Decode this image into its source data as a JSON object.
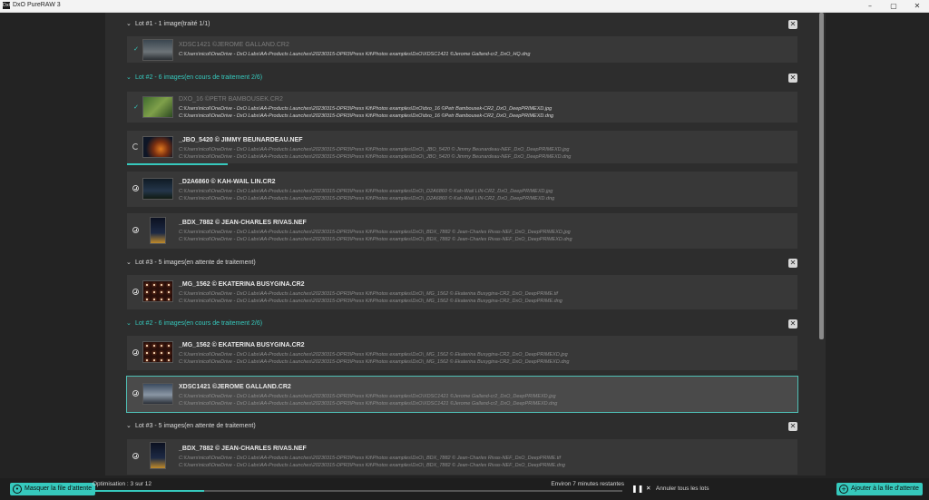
{
  "window": {
    "title": "DxO PureRAW 3",
    "app_icon": "DxO",
    "minimize": "–",
    "maximize": "▢",
    "close": "✕"
  },
  "lots": [
    {
      "chevron": "⌄",
      "title": "Lot  #1 - 1 image(traité 1/1)",
      "state": "done",
      "close": "✕"
    },
    {
      "chevron": "⌄",
      "title": "Lot  #2 - 6 images(en cours de traitement 2/6)",
      "state": "active",
      "close": "✕"
    },
    {
      "chevron": "⌄",
      "title": "Lot  #3 - 5 images(en attente de traitement)",
      "state": "waiting",
      "close": "✕"
    },
    {
      "chevron": "⌄",
      "title": "Lot  #2 - 6 images(en cours de traitement 2/6)",
      "state": "active",
      "close": "✕"
    },
    {
      "chevron": "⌄",
      "title": "Lot  #3 - 5 images(en attente de traitement)",
      "state": "waiting",
      "close": "✕"
    }
  ],
  "files": [
    {
      "status_icon": "✓",
      "name": "XDSC1421 ©JEROME GALLAND.CR2",
      "paths": [
        "C:\\Users\\nicol\\OneDrive - DxO Labs\\AA-Products Launches\\20230315-DPR3\\Press Kit\\Photos examples\\DxO\\XDSC1421 ©Jerome Galland-cr2_DxO_HQ.dng"
      ]
    },
    {
      "status_icon": "✓",
      "name": "DXO_16 ©PETR BAMBOUSEK.CR2",
      "paths": [
        "C:\\Users\\nicol\\OneDrive - DxO Labs\\AA-Products Launches\\20230315-DPR3\\Press Kit\\Photos examples\\DxO\\dxo_16 ©Petr Bambousek-CR2_DxO_DeepPRIMEXD.jpg",
        "C:\\Users\\nicol\\OneDrive - DxO Labs\\AA-Products Launches\\20230315-DPR3\\Press Kit\\Photos examples\\DxO\\dxo_16 ©Petr Bambousek-CR2_DxO_DeepPRIMEXD.dng"
      ]
    },
    {
      "status_icon": "spinner",
      "name": "_JBO_5420 © JIMMY BEUNARDEAU.NEF",
      "paths": [
        "C:\\Users\\nicol\\OneDrive - DxO Labs\\AA-Products Launches\\20230315-DPR3\\Press Kit\\Photos examples\\DxO\\_JBO_5420 © Jimmy Beunardeau-NEF_DxO_DeepPRIMEXD.jpg",
        "C:\\Users\\nicol\\OneDrive - DxO Labs\\AA-Products Launches\\20230315-DPR3\\Press Kit\\Photos examples\\DxO\\_JBO_5420 © Jimmy Beunardeau-NEF_DxO_DeepPRIMEXD.dng"
      ],
      "progress": 0.15
    },
    {
      "status_icon": "clock",
      "name": "_D2A6860 © KAH-WAIL LIN.CR2",
      "paths": [
        "C:\\Users\\nicol\\OneDrive - DxO Labs\\AA-Products Launches\\20230315-DPR3\\Press Kit\\Photos examples\\DxO\\_D2A6860 © Kah-Wail LIN-CR2_DxO_DeepPRIMEXD.jpg",
        "C:\\Users\\nicol\\OneDrive - DxO Labs\\AA-Products Launches\\20230315-DPR3\\Press Kit\\Photos examples\\DxO\\_D2A6860 © Kah-Wail LIN-CR2_DxO_DeepPRIMEXD.dng"
      ]
    },
    {
      "status_icon": "clock",
      "name": "_BDX_7882 © JEAN-CHARLES RIVAS.NEF",
      "paths": [
        "C:\\Users\\nicol\\OneDrive - DxO Labs\\AA-Products Launches\\20230315-DPR3\\Press Kit\\Photos examples\\DxO\\_BDX_7882 © Jean-Charles Rivas-NEF_DxO_DeepPRIMEXD.jpg",
        "C:\\Users\\nicol\\OneDrive - DxO Labs\\AA-Products Launches\\20230315-DPR3\\Press Kit\\Photos examples\\DxO\\_BDX_7882 © Jean-Charles Rivas-NEF_DxO_DeepPRIMEXD.dng"
      ]
    },
    {
      "status_icon": "clock",
      "name": "_MG_1562 © EKATERINA BUSYGINA.CR2",
      "paths": [
        "C:\\Users\\nicol\\OneDrive - DxO Labs\\AA-Products Launches\\20230315-DPR3\\Press Kit\\Photos examples\\DxO\\_MG_1562 © Ekaterina Busygina-CR2_DxO_DeepPRIME.tif",
        "C:\\Users\\nicol\\OneDrive - DxO Labs\\AA-Products Launches\\20230315-DPR3\\Press Kit\\Photos examples\\DxO\\_MG_1562 © Ekaterina Busygina-CR2_DxO_DeepPRIME.dng"
      ]
    },
    {
      "status_icon": "clock",
      "name": "_MG_1562 © EKATERINA BUSYGINA.CR2",
      "paths": [
        "C:\\Users\\nicol\\OneDrive - DxO Labs\\AA-Products Launches\\20230315-DPR3\\Press Kit\\Photos examples\\DxO\\_MG_1562 © Ekaterina Busygina-CR2_DxO_DeepPRIMEXD.jpg",
        "C:\\Users\\nicol\\OneDrive - DxO Labs\\AA-Products Launches\\20230315-DPR3\\Press Kit\\Photos examples\\DxO\\_MG_1562 © Ekaterina Busygina-CR2_DxO_DeepPRIMEXD.dng"
      ]
    },
    {
      "status_icon": "clock",
      "name": "XDSC1421 ©JEROME GALLAND.CR2",
      "paths": [
        "C:\\Users\\nicol\\OneDrive - DxO Labs\\AA-Products Launches\\20230315-DPR3\\Press Kit\\Photos examples\\DxO\\XDSC1421 ©Jerome Galland-cr2_DxO_DeepPRIMEXD.jpg",
        "C:\\Users\\nicol\\OneDrive - DxO Labs\\AA-Products Launches\\20230315-DPR3\\Press Kit\\Photos examples\\DxO\\XDSC1421 ©Jerome Galland-cr2_DxO_DeepPRIMEXD.dng"
      ]
    },
    {
      "status_icon": "clock",
      "name": "_BDX_7882 © JEAN-CHARLES RIVAS.NEF",
      "paths": [
        "C:\\Users\\nicol\\OneDrive - DxO Labs\\AA-Products Launches\\20230315-DPR3\\Press Kit\\Photos examples\\DxO\\_BDX_7882 © Jean-Charles Rivas-NEF_DxO_DeepPRIME.tif",
        "C:\\Users\\nicol\\OneDrive - DxO Labs\\AA-Products Launches\\20230315-DPR3\\Press Kit\\Photos examples\\DxO\\_BDX_7882 © Jean-Charles Rivas-NEF_DxO_DeepPRIME.dng"
      ]
    }
  ],
  "bottom": {
    "hide_queue_label": "Masquer la file d'attente",
    "optimization_label": "Optimisation : 3 sur 12",
    "optimization_progress": 0.21,
    "remaining_label": "Environ 7 minutes restantes",
    "pause_icon": "❚❚",
    "cancel_icon": "✕",
    "cancel_all_label": "Annuler tous les lots",
    "add_to_queue_label": "Ajouter à la file d'attente",
    "add_icon": "+"
  },
  "colors": {
    "accent": "#36c9bd",
    "background": "#232323",
    "panel": "#2d2d2d",
    "row": "#383838"
  }
}
